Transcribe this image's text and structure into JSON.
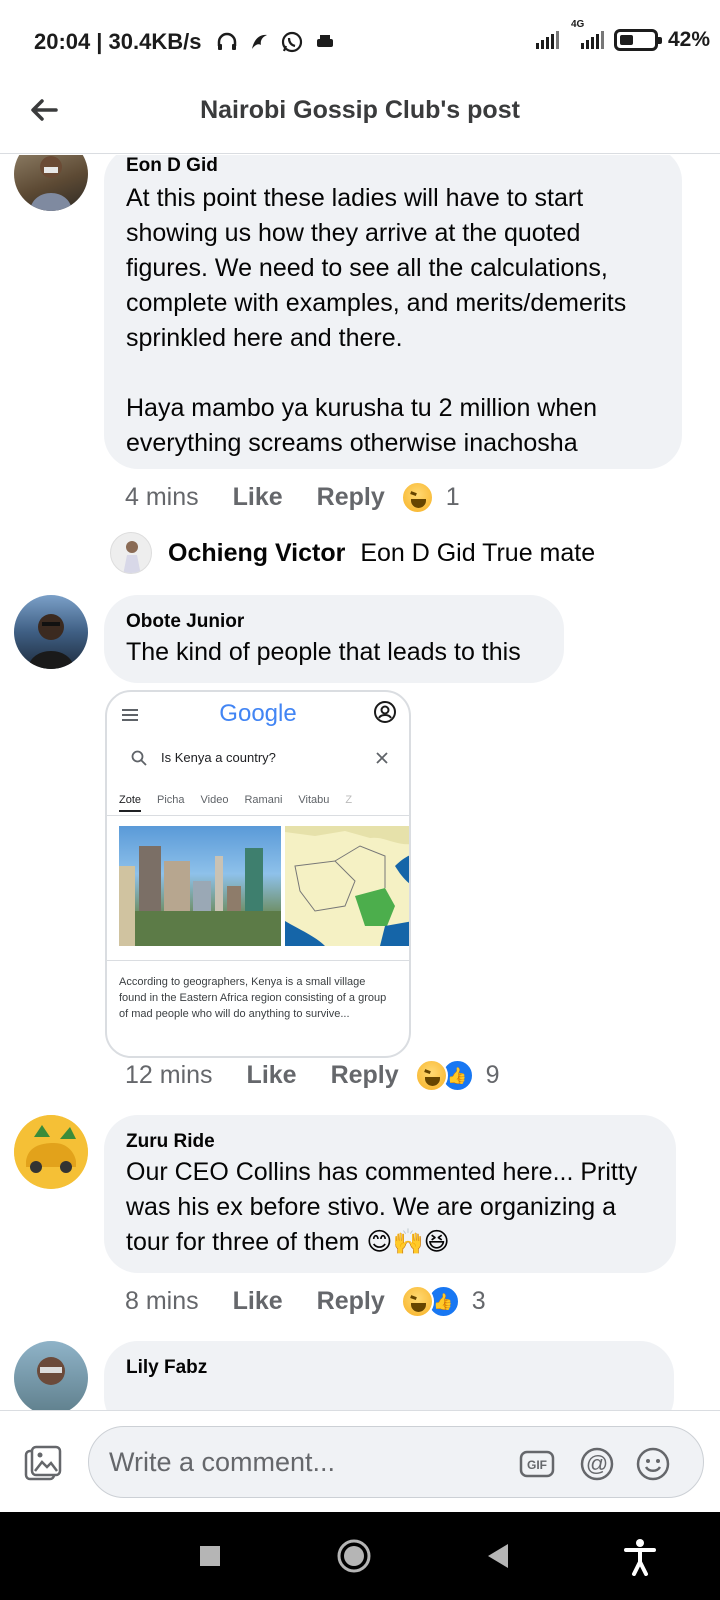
{
  "status_bar": {
    "time": "20:04",
    "speed": "| 30.4KB/s",
    "network": "4G",
    "battery_percent": 42,
    "battery_label": "42%"
  },
  "header": {
    "title": "Nairobi Gossip Club's post"
  },
  "comments": [
    {
      "author": "Eon D Gid",
      "text": "At this point these ladies will have to start showing us how they arrive at the quoted figures. We need to see all the calculations, complete with examples, and merits/demerits sprinkled here and there.\n\nHaya mambo ya kurusha tu 2 million when everything screams otherwise inachosha",
      "time": "4 mins",
      "like_label": "Like",
      "reply_label": "Reply",
      "reaction_count": "1"
    },
    {
      "reply_author": "Ochieng Victor",
      "reply_text": "Eon D Gid True mate"
    },
    {
      "author": "Obote Junior",
      "text": "The kind of people that leads to this",
      "time": "12 mins",
      "like_label": "Like",
      "reply_label": "Reply",
      "reaction_count": "9"
    },
    {
      "author": "Zuru Ride",
      "text": "Our CEO Collins has commented here... Pritty was his ex before stivo. We are organizing a tour for three of them 😊🙌😆",
      "time": "8 mins",
      "like_label": "Like",
      "reply_label": "Reply",
      "reaction_count": "3"
    },
    {
      "author": "Lily Fabz"
    }
  ],
  "attachment": {
    "logo": "Google",
    "query": "Is Kenya a country?",
    "tabs": [
      "Zote",
      "Picha",
      "Video",
      "Ramani",
      "Vitabu",
      "Z"
    ],
    "description": "According to geographers, Kenya is a small village found in the Eastern Africa region consisting of a group of mad people who will do anything to survive..."
  },
  "composer": {
    "placeholder": "Write a comment..."
  }
}
